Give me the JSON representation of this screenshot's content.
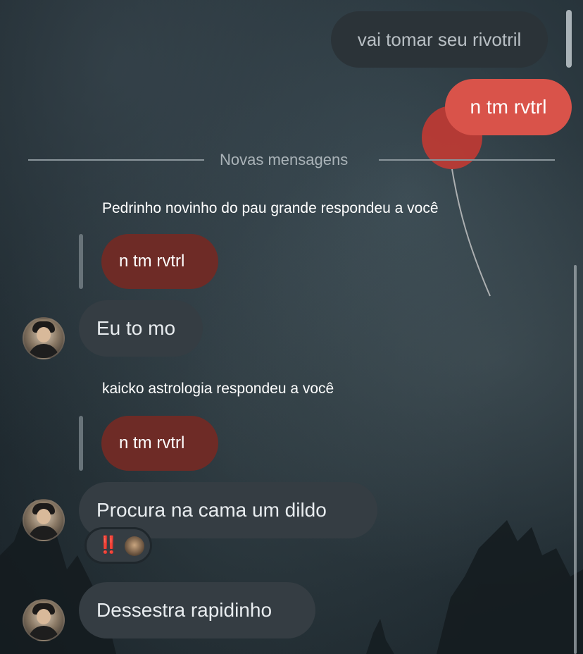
{
  "messages": {
    "sent_top": "vai tomar seu rivotril",
    "sent_reply": "n tm rvtrl"
  },
  "divider": {
    "label": "Novas mensagens"
  },
  "thread": [
    {
      "reply_label": "Pedrinho novinho do pau grande respondeu a você",
      "quoted": "n tm rvtrl",
      "message": "Eu to mo"
    },
    {
      "reply_label": "kaicko astrologia respondeu a você",
      "quoted": "n tm rvtrl",
      "message": "Procura na cama um dildo",
      "reaction": {
        "emoji": "‼️"
      }
    }
  ],
  "last_message": "Dessestra rapidinho",
  "colors": {
    "sent_accent": "#d9534a",
    "incoming_bubble": "#353d43",
    "quoted_bubble": "#6e2b26"
  }
}
